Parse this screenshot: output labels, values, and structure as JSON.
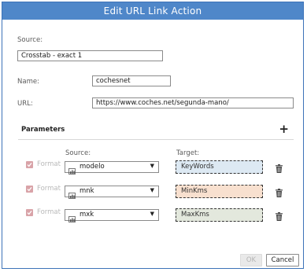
{
  "dialog": {
    "title": "Edit URL Link Action"
  },
  "source": {
    "label": "Source:",
    "value": "Crosstab - exact 1"
  },
  "name": {
    "label": "Name:",
    "value": "cochesnet"
  },
  "url": {
    "label": "URL:",
    "value": "https://www.coches.net/segunda-mano/"
  },
  "parameters": {
    "title": "Parameters",
    "add_icon": "plus-icon",
    "source_header": "Source:",
    "target_header": "Target:",
    "rows": [
      {
        "format_label": "Format",
        "checked": true,
        "source": "modelo",
        "target": "KeyWords",
        "target_color": "#dde9f3"
      },
      {
        "format_label": "Format",
        "checked": true,
        "source": "mnk",
        "target": "MinKms",
        "target_color": "#f8e0cf"
      },
      {
        "format_label": "Format",
        "checked": true,
        "source": "mxk",
        "target": "MaxKms",
        "target_color": "#e3e8dd"
      }
    ]
  },
  "buttons": {
    "ok": "OK",
    "cancel": "Cancel"
  },
  "colors": {
    "title_bar": "#4f87c9",
    "checkbox_disabled": "#d9a3a8"
  }
}
